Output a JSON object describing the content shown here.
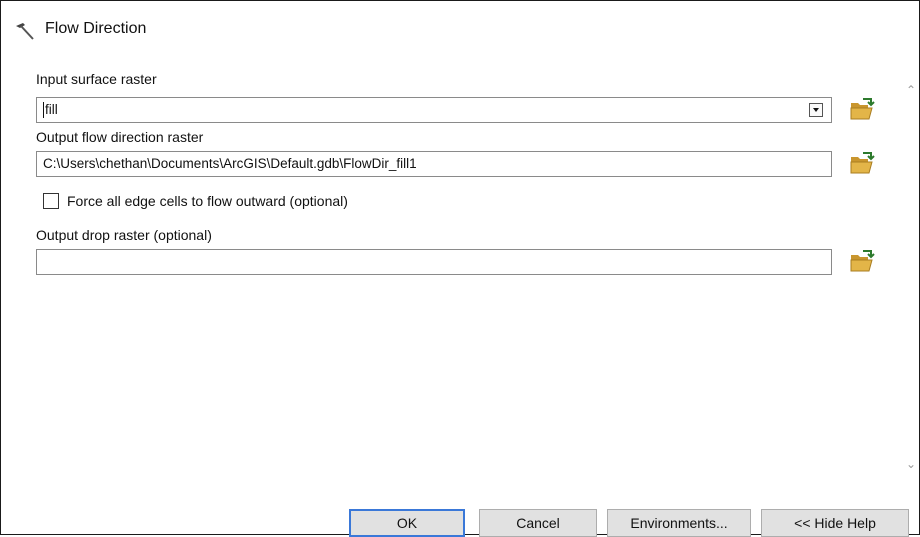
{
  "window": {
    "title": "Flow Direction",
    "icon": "hammer-tool-icon"
  },
  "form": {
    "input_surface": {
      "label": "Input surface raster",
      "value": "fill"
    },
    "output_flow_direction": {
      "label": "Output flow direction raster",
      "value": "C:\\Users\\chethan\\Documents\\ArcGIS\\Default.gdb\\FlowDir_fill1"
    },
    "force_edge": {
      "label": "Force all edge cells to flow outward (optional)",
      "checked": false
    },
    "output_drop": {
      "label": "Output drop raster (optional)",
      "value": ""
    }
  },
  "buttons": {
    "ok": "OK",
    "cancel": "Cancel",
    "environments": "Environments...",
    "hide_help": "<< Hide Help"
  },
  "colors": {
    "ok_border": "#3a78d8",
    "folder": "#e3b548"
  }
}
